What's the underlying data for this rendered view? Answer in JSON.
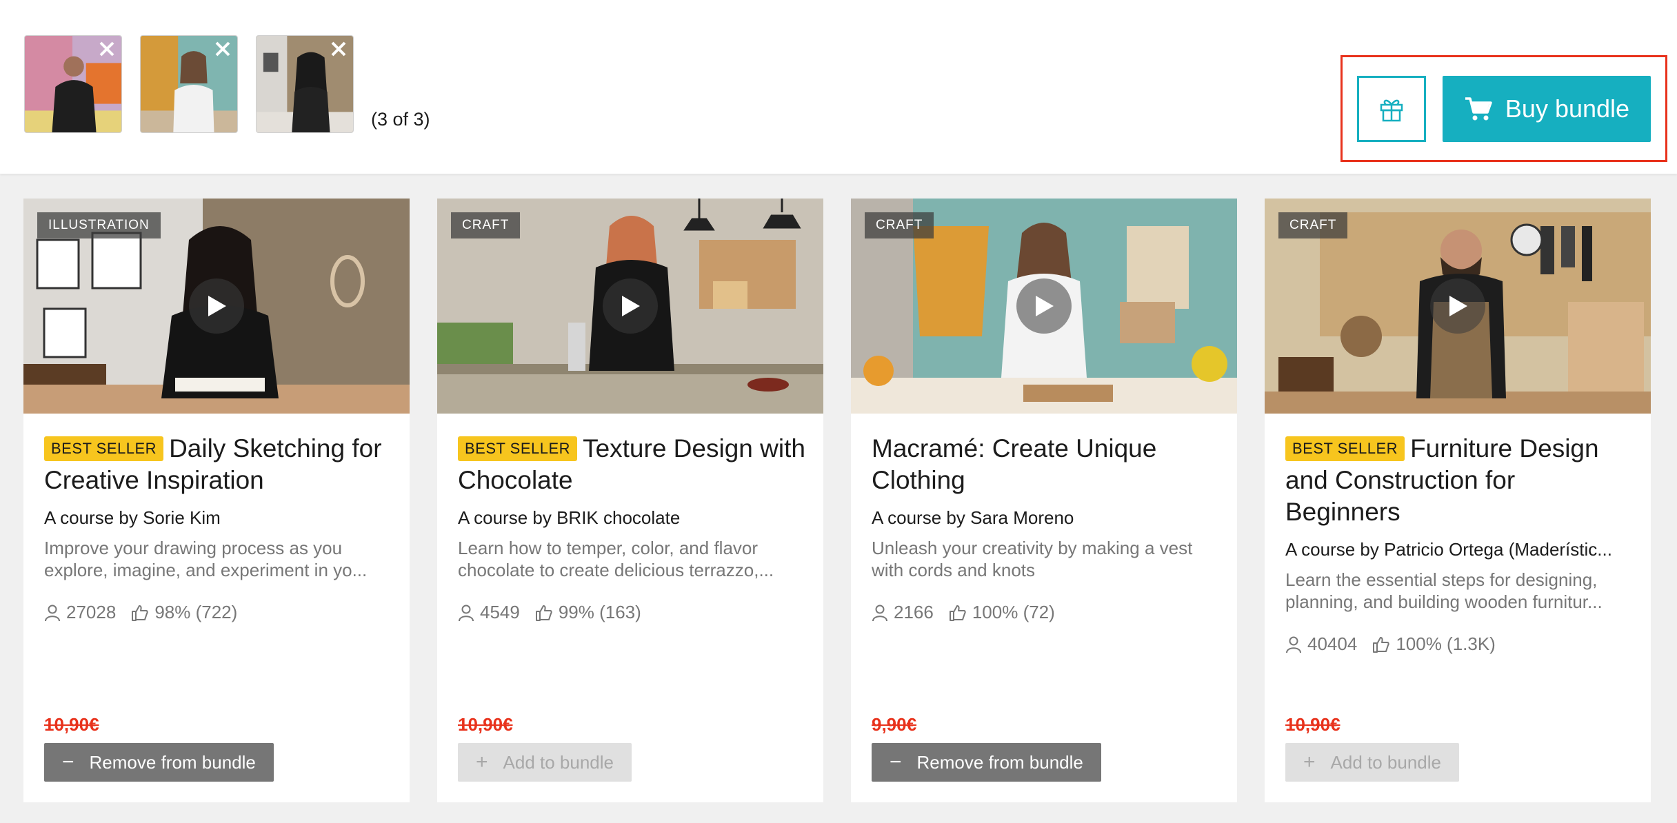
{
  "bundle": {
    "count_label": "(3 of 3)",
    "buy_label": "Buy bundle",
    "thumbnails": [
      {
        "name": "thumb-1"
      },
      {
        "name": "thumb-2"
      },
      {
        "name": "thumb-3"
      }
    ],
    "accent_color": "#16afc0",
    "highlight_color": "#e8321c"
  },
  "courses": [
    {
      "category": "ILLUSTRATION",
      "badge": "BEST SELLER",
      "title": "Daily Sketching for Creative Inspiration",
      "author": "A course by Sorie Kim",
      "description": "Improve your drawing process as you explore, imagine, and experiment in yo...",
      "students": "27028",
      "rating": "98% (722)",
      "price": "10,90€",
      "action": "Remove from bundle",
      "action_symbol": "−"
    },
    {
      "category": "CRAFT",
      "badge": "BEST SELLER",
      "title": "Texture Design with Chocolate",
      "author": "A course by BRIK chocolate",
      "description": "Learn how to temper, color, and flavor chocolate to create delicious terrazzo,...",
      "students": "4549",
      "rating": "99% (163)",
      "price": "10,90€",
      "action": "Add to bundle",
      "action_symbol": "+"
    },
    {
      "category": "CRAFT",
      "badge": "",
      "title": "Macramé: Create Unique Clothing",
      "author": "A course by Sara Moreno",
      "description": "Unleash your creativity by making a vest with cords and knots",
      "students": "2166",
      "rating": "100% (72)",
      "price": "9,90€",
      "action": "Remove from bundle",
      "action_symbol": "−"
    },
    {
      "category": "CRAFT",
      "badge": "BEST SELLER",
      "title": "Furniture Design and Construction for Beginners",
      "author": "A course by Patricio Ortega (Maderístic...",
      "description": "Learn the essential steps for designing, planning, and building wooden furnitur...",
      "students": "40404",
      "rating": "100% (1.3K)",
      "price": "10,90€",
      "action": "Add to bundle",
      "action_symbol": "+"
    }
  ]
}
